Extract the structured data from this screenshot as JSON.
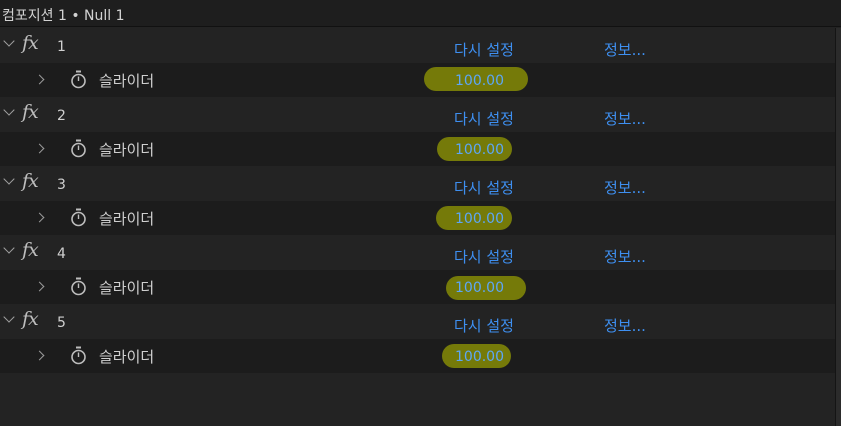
{
  "window": {
    "title": "컴포지션 1 • Null 1"
  },
  "colors": {
    "link": "#3e8ff0",
    "value": "#5da6f5",
    "highlight": "#7a7f08"
  },
  "effects": [
    {
      "number": "1",
      "fx_label": "fx",
      "reset_label": "다시 설정",
      "about_label": "정보...",
      "param": {
        "label": "슬라이더",
        "value": "100.00",
        "icon": "stopwatch-icon"
      }
    },
    {
      "number": "2",
      "fx_label": "fx",
      "reset_label": "다시 설정",
      "about_label": "정보...",
      "param": {
        "label": "슬라이더",
        "value": "100.00",
        "icon": "stopwatch-icon"
      }
    },
    {
      "number": "3",
      "fx_label": "fx",
      "reset_label": "다시 설정",
      "about_label": "정보...",
      "param": {
        "label": "슬라이더",
        "value": "100.00",
        "icon": "stopwatch-icon"
      }
    },
    {
      "number": "4",
      "fx_label": "fx",
      "reset_label": "다시 설정",
      "about_label": "정보...",
      "param": {
        "label": "슬라이더",
        "value": "100.00",
        "icon": "stopwatch-icon"
      }
    },
    {
      "number": "5",
      "fx_label": "fx",
      "reset_label": "다시 설정",
      "about_label": "정보...",
      "param": {
        "label": "슬라이더",
        "value": "100.00",
        "icon": "stopwatch-icon"
      }
    }
  ]
}
